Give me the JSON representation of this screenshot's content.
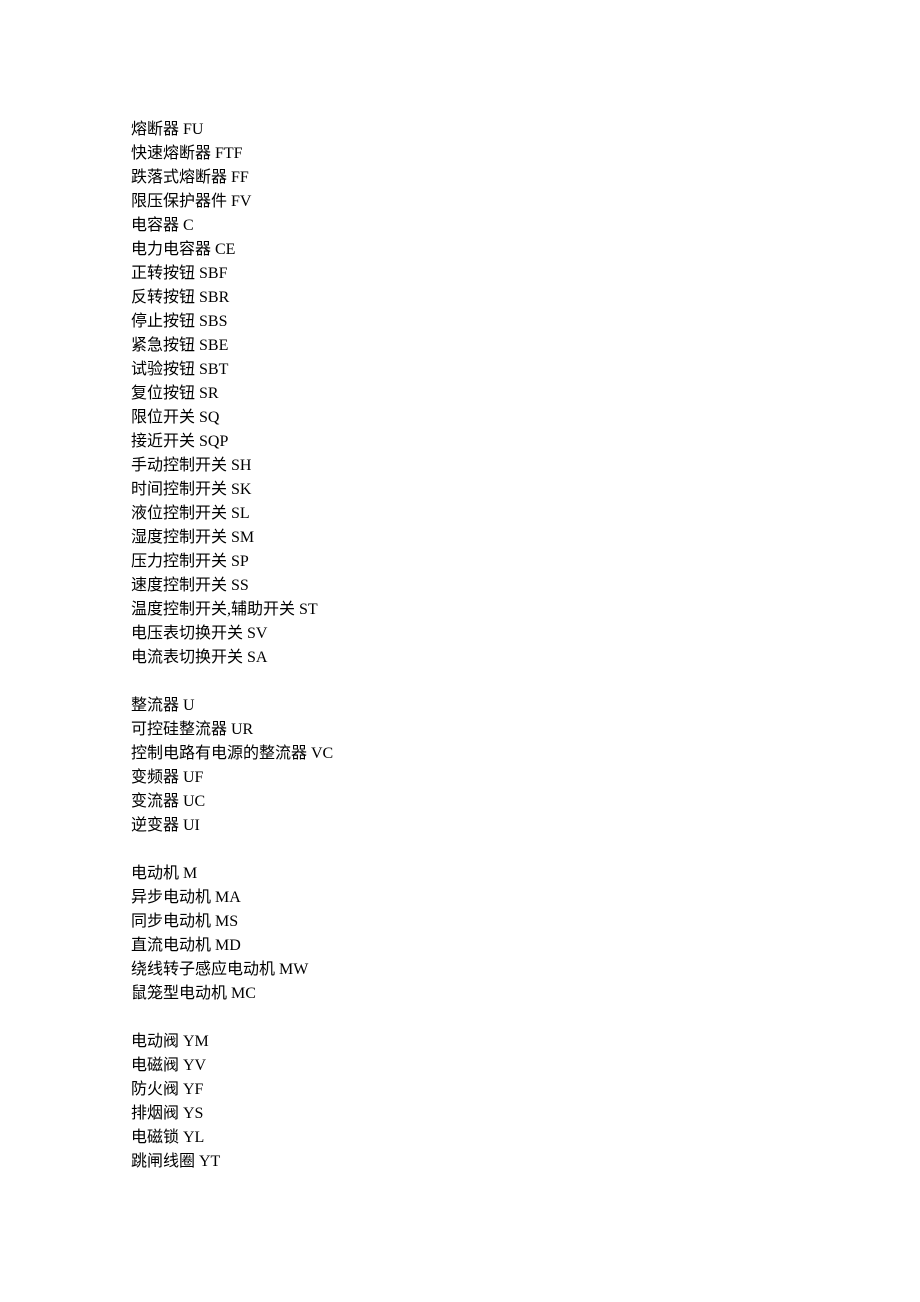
{
  "groups": [
    [
      {
        "name": "熔断器",
        "code": "FU"
      },
      {
        "name": "快速熔断器",
        "code": "FTF"
      },
      {
        "name": "跌落式熔断器",
        "code": "FF"
      },
      {
        "name": "限压保护器件",
        "code": "FV"
      },
      {
        "name": "电容器",
        "code": "C"
      },
      {
        "name": "电力电容器",
        "code": "CE"
      },
      {
        "name": "正转按钮",
        "code": "SBF"
      },
      {
        "name": "反转按钮",
        "code": "SBR"
      },
      {
        "name": "停止按钮",
        "code": "SBS"
      },
      {
        "name": "紧急按钮",
        "code": "SBE"
      },
      {
        "name": "试验按钮",
        "code": "SBT"
      },
      {
        "name": "复位按钮",
        "code": "SR"
      },
      {
        "name": "限位开关",
        "code": "SQ"
      },
      {
        "name": "接近开关",
        "code": "SQP"
      },
      {
        "name": "手动控制开关",
        "code": "SH"
      },
      {
        "name": "时间控制开关",
        "code": "SK"
      },
      {
        "name": "液位控制开关",
        "code": "SL"
      },
      {
        "name": "湿度控制开关",
        "code": "SM"
      },
      {
        "name": "压力控制开关",
        "code": "SP"
      },
      {
        "name": "速度控制开关",
        "code": "SS"
      },
      {
        "name": "温度控制开关,辅助开关",
        "code": "ST"
      },
      {
        "name": "电压表切换开关",
        "code": "SV"
      },
      {
        "name": "电流表切换开关",
        "code": "SA"
      }
    ],
    [
      {
        "name": "整流器",
        "code": "U"
      },
      {
        "name": "可控硅整流器",
        "code": "UR"
      },
      {
        "name": "控制电路有电源的整流器",
        "code": "VC"
      },
      {
        "name": "变频器",
        "code": "UF"
      },
      {
        "name": "变流器",
        "code": "UC"
      },
      {
        "name": "逆变器",
        "code": "UI"
      }
    ],
    [
      {
        "name": "电动机",
        "code": "M"
      },
      {
        "name": "异步电动机",
        "code": "MA"
      },
      {
        "name": "同步电动机",
        "code": "MS"
      },
      {
        "name": "直流电动机",
        "code": "MD"
      },
      {
        "name": "绕线转子感应电动机",
        "code": "MW"
      },
      {
        "name": "鼠笼型电动机",
        "code": "MC"
      }
    ],
    [
      {
        "name": "电动阀",
        "code": "YM"
      },
      {
        "name": "电磁阀",
        "code": "YV"
      },
      {
        "name": "防火阀",
        "code": "YF"
      },
      {
        "name": "排烟阀",
        "code": "YS"
      },
      {
        "name": "电磁锁",
        "code": "YL"
      },
      {
        "name": "跳闸线圈",
        "code": "YT"
      }
    ]
  ]
}
